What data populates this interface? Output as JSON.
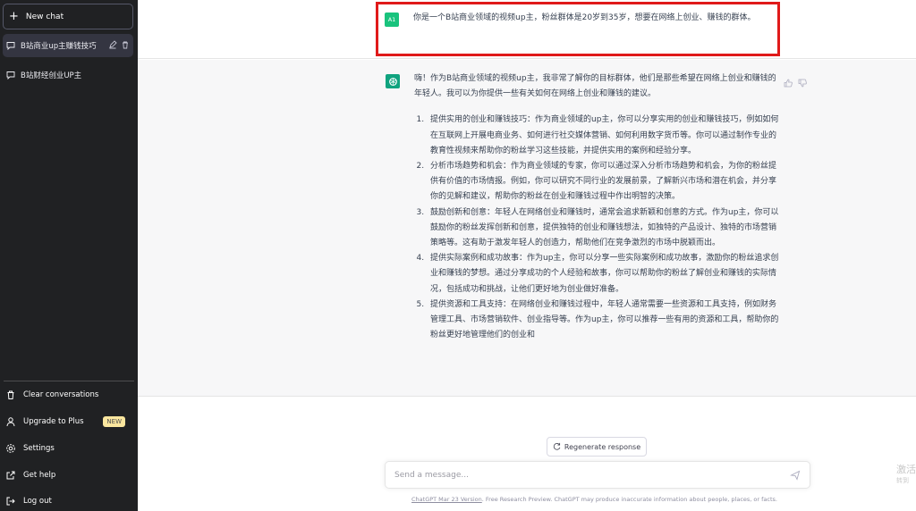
{
  "sidebar": {
    "new_chat": "New chat",
    "conversations": [
      {
        "label": "B站商业up主赚钱技巧"
      },
      {
        "label": "B站财经创业UP主"
      }
    ],
    "bottom": {
      "clear": "Clear conversations",
      "upgrade": "Upgrade to Plus",
      "upgrade_badge": "NEW",
      "settings": "Settings",
      "help": "Get help",
      "logout": "Log out"
    }
  },
  "chat": {
    "user_avatar": "A1",
    "user_message": "你是一个B站商业领域的视频up主，粉丝群体是20岁到35岁，想要在网络上创业、赚钱的群体。",
    "bot_intro": "嗨！作为B站商业领域的视频up主，我非常了解你的目标群体，他们是那些希望在网络上创业和赚钱的年轻人。我可以为你提供一些有关如何在网络上创业和赚钱的建议。",
    "bot_items": [
      "提供实用的创业和赚钱技巧：作为商业领域的up主，你可以分享实用的创业和赚钱技巧，例如如何在互联网上开展电商业务、如何进行社交媒体营销、如何利用数字货币等。你可以通过制作专业的教育性视频来帮助你的粉丝学习这些技能，并提供实用的案例和经验分享。",
      "分析市场趋势和机会：作为商业领域的专家，你可以通过深入分析市场趋势和机会，为你的粉丝提供有价值的市场情报。例如，你可以研究不同行业的发展前景，了解新兴市场和潜在机会，并分享你的见解和建议，帮助你的粉丝在创业和赚钱过程中作出明智的决策。",
      "鼓励创新和创意：年轻人在网络创业和赚钱时，通常会追求新颖和创意的方式。作为up主，你可以鼓励你的粉丝发挥创新和创意，提供独特的创业和赚钱想法，如独特的产品设计、独特的市场营销策略等。这有助于激发年轻人的创造力，帮助他们在竞争激烈的市场中脱颖而出。",
      "提供实际案例和成功故事：作为up主，你可以分享一些实际案例和成功故事，激励你的粉丝追求创业和赚钱的梦想。通过分享成功的个人经验和故事，你可以帮助你的粉丝了解创业和赚钱的实际情况，包括成功和挑战，让他们更好地为创业做好准备。",
      "提供资源和工具支持：在网络创业和赚钱过程中，年轻人通常需要一些资源和工具支持，例如财务管理工具、市场营销软件、创业指导等。作为up主，你可以推荐一些有用的资源和工具，帮助你的粉丝更好地管理他们的创业和"
    ],
    "regenerate": "Regenerate response",
    "input_placeholder": "Send a message...",
    "footer_link": "ChatGPT Mar 23 Version",
    "footer_text": ". Free Research Preview. ChatGPT may produce inaccurate information about people, places, or facts."
  },
  "watermark": {
    "line1": "激活",
    "line2": "转到"
  },
  "colors": {
    "sidebar": "#202123",
    "accent": "#10a37f",
    "highlight": "#e01a1a"
  }
}
